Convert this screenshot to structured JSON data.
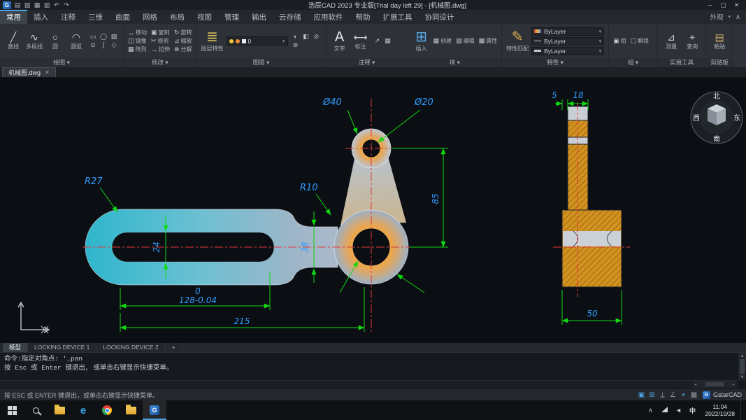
{
  "titlebar": {
    "title": "浩辰CAD 2023 专业版[Trial day left 29] - [机械图.dwg]",
    "logo_letter": "G",
    "quick_icons": [
      {
        "n": "new-icon",
        "g": "▤"
      },
      {
        "n": "open-icon",
        "g": "▨"
      },
      {
        "n": "save-icon",
        "g": "▦"
      },
      {
        "n": "plot-icon",
        "g": "▥"
      },
      {
        "n": "undo-icon",
        "g": "↶"
      },
      {
        "n": "redo-icon",
        "g": "↷"
      }
    ],
    "window_controls": [
      {
        "n": "minimize-button",
        "g": "─"
      },
      {
        "n": "maximize-button",
        "g": "▢"
      },
      {
        "n": "close-button",
        "g": "✕"
      }
    ]
  },
  "ribbon": {
    "tabs": [
      "常用",
      "插入",
      "注释",
      "三维",
      "曲面",
      "网格",
      "布局",
      "视图",
      "管理",
      "输出",
      "云存储",
      "应用软件",
      "帮助",
      "扩展工具",
      "协同设计"
    ],
    "active_tab": "常用",
    "appearance_label": "外观",
    "collapse_glyph": "∧",
    "panels": [
      {
        "name": "draw",
        "footer": "绘图",
        "arrow": true,
        "tools": [
          {
            "n": "line",
            "g": "╱",
            "l": "直线"
          },
          {
            "n": "polyline",
            "g": "∿",
            "l": "多段线"
          },
          {
            "n": "circle",
            "g": "○",
            "l": "圆"
          },
          {
            "n": "arc",
            "g": "◠",
            "l": "圆弧"
          }
        ],
        "minis": [
          {
            "n": "rectangle",
            "g": "▭"
          },
          {
            "n": "ellipse",
            "g": "◯"
          },
          {
            "n": "hatch",
            "g": "▨"
          },
          {
            "n": "point",
            "g": "⊙"
          },
          {
            "n": "spline",
            "g": "∫"
          },
          {
            "n": "polygon",
            "g": "◇"
          }
        ]
      },
      {
        "name": "modify",
        "footer": "修改",
        "arrow": true,
        "minis2": [
          {
            "n": "move",
            "g": "↔",
            "l": "移动"
          },
          {
            "n": "copy",
            "g": "▣",
            "l": "复制"
          },
          {
            "n": "rotate",
            "g": "↻",
            "l": "旋转"
          },
          {
            "n": "mirror",
            "g": "◫",
            "l": "镜像"
          },
          {
            "n": "trim",
            "g": "✂",
            "l": "修剪"
          },
          {
            "n": "scale",
            "g": "⊿",
            "l": "缩放"
          },
          {
            "n": "array",
            "g": "▦",
            "l": "阵列"
          },
          {
            "n": "stretch",
            "g": "→",
            "l": "拉伸"
          },
          {
            "n": "explode",
            "g": "⊗",
            "l": "分解"
          }
        ]
      },
      {
        "name": "layers",
        "footer": "图层",
        "arrow": true,
        "tools": [
          {
            "n": "layer-properties",
            "g": "≣",
            "l": "图层特性",
            "big": true,
            "c": "#d9c35a"
          }
        ],
        "layer_field": {
          "value": "0"
        },
        "minis": [
          {
            "n": "layer-state",
            "g": "◐"
          },
          {
            "n": "layer-isolate",
            "g": "◧"
          },
          {
            "n": "layer-lock",
            "g": "⊘"
          },
          {
            "n": "layer-match",
            "g": "⊜"
          }
        ]
      },
      {
        "name": "annotate",
        "footer": "注释",
        "arrow": true,
        "tools": [
          {
            "n": "text",
            "g": "A",
            "l": "文字",
            "big": true,
            "c": "#e6ebf0"
          },
          {
            "n": "dimension",
            "g": "⟷",
            "l": "标注"
          }
        ],
        "minis": [
          {
            "n": "leader",
            "g": "↗"
          },
          {
            "n": "table",
            "g": "▦"
          }
        ]
      },
      {
        "name": "block",
        "footer": "块",
        "arrow": true,
        "tools": [
          {
            "n": "insert",
            "g": "⊞",
            "l": "插入",
            "big": true,
            "c": "#58a8e8"
          }
        ],
        "minis2": [
          {
            "n": "create-block",
            "g": "▦",
            "l": "创建"
          },
          {
            "n": "edit-block",
            "g": "▧",
            "l": "编辑"
          },
          {
            "n": "block-attributes",
            "g": "▩",
            "l": "属性"
          }
        ]
      },
      {
        "name": "properties",
        "footer": "特性",
        "arrow": true,
        "tools": [
          {
            "n": "match-properties",
            "g": "✎",
            "l": "特性匹配",
            "big": true,
            "c": "#e0b050"
          }
        ],
        "selects": [
          {
            "n": "color",
            "v": "ByLayer"
          },
          {
            "n": "linetype",
            "v": "ByLayer"
          },
          {
            "n": "lineweight",
            "v": "ByLayer"
          }
        ]
      },
      {
        "name": "groups",
        "footer": "组",
        "arrow": true,
        "minis2": [
          {
            "n": "group",
            "g": "▣",
            "l": "组"
          },
          {
            "n": "ungroup",
            "g": "▢",
            "l": "解组"
          }
        ]
      },
      {
        "name": "utilities",
        "footer": "实用工具",
        "arrow": false,
        "tools": [
          {
            "n": "measure",
            "g": "⊿",
            "l": "测量"
          },
          {
            "n": "inquiry",
            "g": "⌖",
            "l": "查询"
          }
        ]
      },
      {
        "name": "clipboard",
        "footer": "剪贴板",
        "arrow": false,
        "tools": [
          {
            "n": "paste",
            "g": "▤",
            "l": "粘贴",
            "c": "#c9a86a"
          }
        ]
      }
    ]
  },
  "doctab": {
    "label": "机械图.dwg",
    "close": "✕"
  },
  "canvas": {
    "compass": {
      "n": "北",
      "s": "南",
      "w": "西",
      "e": "东"
    },
    "dims": {
      "d40": "Ø40",
      "d20": "Ø20",
      "r27": "R27",
      "r10": "R10",
      "v85": "85",
      "v24": "24",
      "v38": "38",
      "tol": "0",
      "len": "128-0.04",
      "total": "215",
      "s5": "5",
      "s18": "18",
      "s50": "50"
    }
  },
  "layout_tabs": [
    "模型",
    "LOCKING DEVICE 1",
    "LOCKING DEVICE 2",
    "+"
  ],
  "command": {
    "line1": "命令:指定对角点: '_pan",
    "line2": "按 Esc 或 Enter 键退出, 或单击右键显示快捷菜单。"
  },
  "statusbar": {
    "hint": "按 ESC 或 ENTER 键退出，或单击右键显示快捷菜单。",
    "icons": [
      {
        "n": "model-space-icon",
        "g": "▣",
        "on": true
      },
      {
        "n": "grid-icon",
        "g": "⊞",
        "on": true
      },
      {
        "n": "ortho-icon",
        "g": "⟂",
        "on": false
      },
      {
        "n": "polar-icon",
        "g": "∠",
        "on": false
      },
      {
        "n": "osnap-icon",
        "g": "⌖",
        "on": true
      },
      {
        "n": "lineweight-icon",
        "g": "▦",
        "on": false
      }
    ],
    "brand": "GstarCAD",
    "brand_letter": "G"
  },
  "taskbar": {
    "lang": "中",
    "time": "11:04",
    "date": "2022/10/28",
    "edge_glyph": "e",
    "cad_glyph": "G",
    "tray_expand": "∧",
    "volume_glyph": "◄"
  },
  "colors": {
    "dim_line": "#12d812",
    "dim_text": "#2e9bff",
    "centerline": "#e23b3b",
    "hatch": "#d3921f",
    "accent": "#4aa3e0",
    "part_cyan": "#2eb6cc"
  }
}
